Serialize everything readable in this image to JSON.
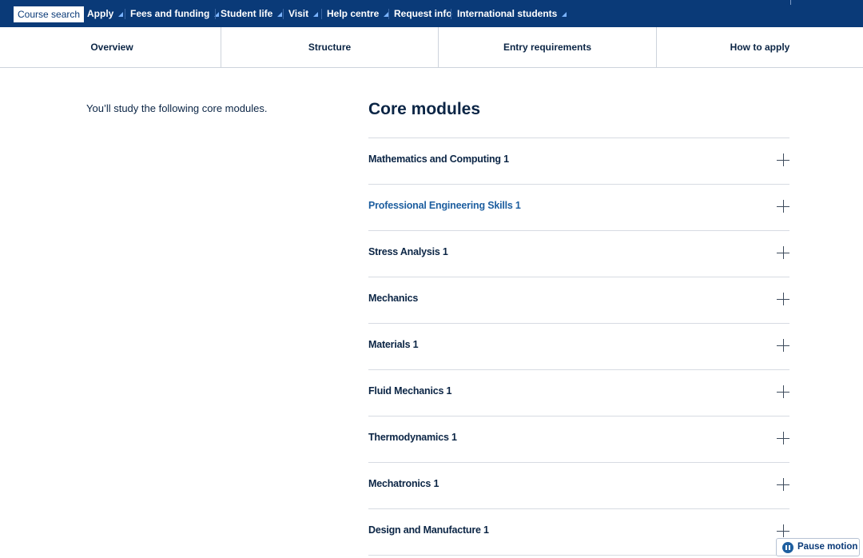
{
  "topnav": {
    "items": [
      {
        "label": "Course search",
        "has_arrow": false
      },
      {
        "label": "Apply",
        "has_arrow": true
      },
      {
        "label": "Fees and funding",
        "has_arrow": true
      },
      {
        "label": "Student life",
        "has_arrow": true
      },
      {
        "label": "Visit",
        "has_arrow": true
      },
      {
        "label": "Help centre",
        "has_arrow": true
      },
      {
        "label": "Request info",
        "has_arrow": false
      },
      {
        "label": "International students",
        "has_arrow": true
      }
    ],
    "active_index": 0,
    "arrow_icon": "triangle-down-right-icon"
  },
  "tabs": {
    "items": [
      {
        "label": "Overview"
      },
      {
        "label": "Structure"
      },
      {
        "label": "Entry requirements"
      },
      {
        "label": "How to apply"
      }
    ]
  },
  "main": {
    "intro": "You’ll study the following core modules.",
    "heading": "Core modules",
    "modules": [
      {
        "label": "Mathematics and Computing 1"
      },
      {
        "label": "Professional Engineering Skills 1"
      },
      {
        "label": "Stress Analysis 1"
      },
      {
        "label": "Mechanics"
      },
      {
        "label": "Materials 1"
      },
      {
        "label": "Fluid Mechanics 1"
      },
      {
        "label": "Thermodynamics 1"
      },
      {
        "label": "Mechatronics 1"
      },
      {
        "label": "Design and Manufacture 1"
      }
    ],
    "expand_icon": "plus-icon",
    "highlight_color": "#1e5fa0"
  },
  "pause_motion": {
    "label": "Pause motion",
    "icon": "pause-icon"
  },
  "colors": {
    "nav_background": "#0a3a78",
    "text_primary": "#0b2545",
    "divider": "#d7dbe2"
  }
}
